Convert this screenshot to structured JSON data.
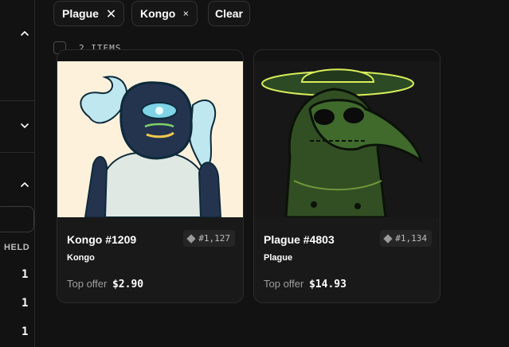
{
  "filters": {
    "chips": [
      {
        "label": "Plague",
        "remove_icon": "close-icon"
      },
      {
        "label": "Kongo",
        "remove_icon": "close-icon"
      }
    ],
    "clear_label": "Clear"
  },
  "results": {
    "count_label": "2 ITEMS"
  },
  "sidebar": {
    "chevrons": [
      "chevron-up-icon",
      "chevron-down-icon",
      "chevron-up-icon"
    ],
    "held_label": "HELD",
    "held_values": [
      "1",
      "1",
      "1"
    ]
  },
  "cards": [
    {
      "name": "Kongo #1209",
      "rank": "#1,127",
      "collection": "Kongo",
      "offer_label": "Top offer",
      "offer_price": "$2.90",
      "image_bg": "#fdf1dc"
    },
    {
      "name": "Plague #4803",
      "rank": "#1,134",
      "collection": "Plague",
      "offer_label": "Top offer",
      "offer_price": "$14.93",
      "image_bg": "#171717"
    }
  ],
  "colors": {
    "background": "#121212",
    "card": "#191919",
    "border": "#2b2b2b",
    "muted_text": "#9e9e9e"
  }
}
